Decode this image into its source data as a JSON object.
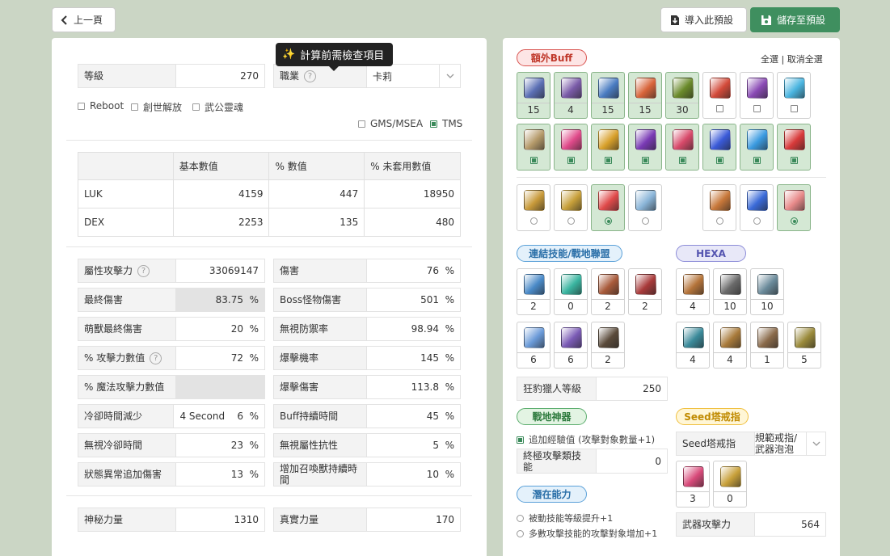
{
  "toolbar": {
    "back": "上一頁",
    "import": "導入此預設",
    "save": "儲存至預設"
  },
  "tooltip": "計算前需檢查項目",
  "left": {
    "level_label": "等級",
    "level_value": "270",
    "job_label": "職業",
    "job_value": "卡莉",
    "checks": [
      "Reboot",
      "創世解放",
      "武公靈魂"
    ],
    "region": [
      "GMS/MSEA",
      "TMS"
    ],
    "stat_table": {
      "headers": [
        "",
        "基本數值",
        "% 數值",
        "% 未套用數值"
      ],
      "rows": [
        [
          "LUK",
          "4159",
          "447",
          "18950"
        ],
        [
          "DEX",
          "2253",
          "135",
          "480"
        ]
      ]
    },
    "stats_left": [
      {
        "label": "屬性攻擊力",
        "value": "33069147",
        "help": true
      },
      {
        "label": "最終傷害",
        "value": "83.75  %",
        "shaded": true
      },
      {
        "label": "萌獸最終傷害",
        "value": "20  %"
      },
      {
        "label": "% 攻擊力數值",
        "value": "72  %",
        "help": true
      },
      {
        "label": "% 魔法攻擊力數值",
        "value": "",
        "shaded": true
      },
      {
        "label": "冷卻時間減少",
        "value": "4 Second    6  %"
      },
      {
        "label": "無視冷卻時間",
        "value": "23  %"
      },
      {
        "label": "狀態異常追加傷害",
        "value": "13  %"
      }
    ],
    "stats_right": [
      {
        "label": "傷害",
        "value": "76  %"
      },
      {
        "label": "Boss怪物傷害",
        "value": "501  %"
      },
      {
        "label": "無視防禦率",
        "value": "98.94  %"
      },
      {
        "label": "爆擊機率",
        "value": "145  %"
      },
      {
        "label": "爆擊傷害",
        "value": "113.8  %"
      },
      {
        "label": "Buff持續時間",
        "value": "45  %"
      },
      {
        "label": "無視屬性抗性",
        "value": "5  %"
      },
      {
        "label": "增加召喚獸持續時間",
        "value": "10  %"
      }
    ],
    "arcane_label": "神秘力量",
    "arcane_value": "1310",
    "authentic_label": "真實力量",
    "authentic_value": "170"
  },
  "right": {
    "extra_buff_title": "額外Buff",
    "select_all": "全選",
    "deselect_all": "取消全選",
    "buff_row1": [
      {
        "num": "15",
        "sel": true,
        "color": "#5b6fb5"
      },
      {
        "num": "4",
        "sel": true,
        "color": "#7a5ba8"
      },
      {
        "num": "15",
        "sel": true,
        "color": "#4a7cc2"
      },
      {
        "num": "15",
        "sel": true,
        "color": "#d8643a"
      },
      {
        "num": "30",
        "sel": true,
        "color": "#6a8a2a"
      },
      {
        "num": "",
        "sel": false,
        "color": "#d34a3a"
      },
      {
        "num": "",
        "sel": false,
        "color": "#8a4ab5"
      },
      {
        "num": "",
        "sel": false,
        "color": "#4ab5e0"
      }
    ],
    "buff_row2": [
      {
        "sel": true,
        "color": "#b59a6a"
      },
      {
        "sel": true,
        "color": "#e04a8a"
      },
      {
        "sel": true,
        "color": "#d8a02a"
      },
      {
        "sel": true,
        "color": "#7a3ab5"
      },
      {
        "sel": true,
        "color": "#d84a6a"
      },
      {
        "sel": true,
        "color": "#3a5ad8"
      },
      {
        "sel": true,
        "color": "#3a9ae0"
      },
      {
        "sel": true,
        "color": "#d83a3a"
      }
    ],
    "buff_row3": [
      {
        "sel": false,
        "color": "#c89a3a"
      },
      {
        "sel": false,
        "color": "#c8a03a"
      },
      {
        "sel": true,
        "color": "#e04a4a"
      },
      {
        "sel": false,
        "color": "#8ab5d8"
      },
      {
        "sel": false,
        "color": "#c8783a"
      },
      {
        "sel": false,
        "color": "#3a6ad8"
      },
      {
        "sel": true,
        "color": "#e88a8a"
      }
    ],
    "link_title": "連結技能/戰地聯盟",
    "link_tiles": [
      {
        "num": "2",
        "color": "#4a8ac8"
      },
      {
        "num": "0",
        "color": "#3ab5a0"
      },
      {
        "num": "2",
        "color": "#a85a3a"
      },
      {
        "num": "2",
        "color": "#a83a3a"
      },
      {
        "num": "6",
        "color": "#6a9ad8"
      },
      {
        "num": "6",
        "color": "#7a5ab5"
      },
      {
        "num": "2",
        "color": "#5a4a3a"
      }
    ],
    "hexa_title": "HEXA",
    "hexa_tiles": [
      {
        "num": "4",
        "color": "#b5743a"
      },
      {
        "num": "10",
        "color": "#6a6a6a"
      },
      {
        "num": "10",
        "color": "#6a8a9a"
      },
      {
        "num": "4",
        "color": "#3a8a9a"
      },
      {
        "num": "4",
        "color": "#a87a3a"
      },
      {
        "num": "1",
        "color": "#8a6a4a"
      },
      {
        "num": "5",
        "color": "#9a8a3a"
      }
    ],
    "hunter_label": "狂豹獵人等級",
    "hunter_value": "250",
    "artifact_title": "戰地神器",
    "artifact_check": "追加經驗值 (攻擊對象數量+1)",
    "final_atk_label": "終極攻擊類技能",
    "final_atk_value": "0",
    "potential_title": "潛在能力",
    "potential_options": [
      "被動技能等級提升+1",
      "多數攻擊技能的攻擊對象增加+1"
    ],
    "seed_title": "Seed塔戒指",
    "seed_label": "Seed塔戒指",
    "seed_value": "規範戒指/武器泡泡",
    "seed_tiles": [
      {
        "num": "3",
        "color": "#d84a7a"
      },
      {
        "num": "0",
        "color": "#c8a03a"
      }
    ],
    "weapon_atk_label": "武器攻擊力",
    "weapon_atk_value": "564"
  }
}
